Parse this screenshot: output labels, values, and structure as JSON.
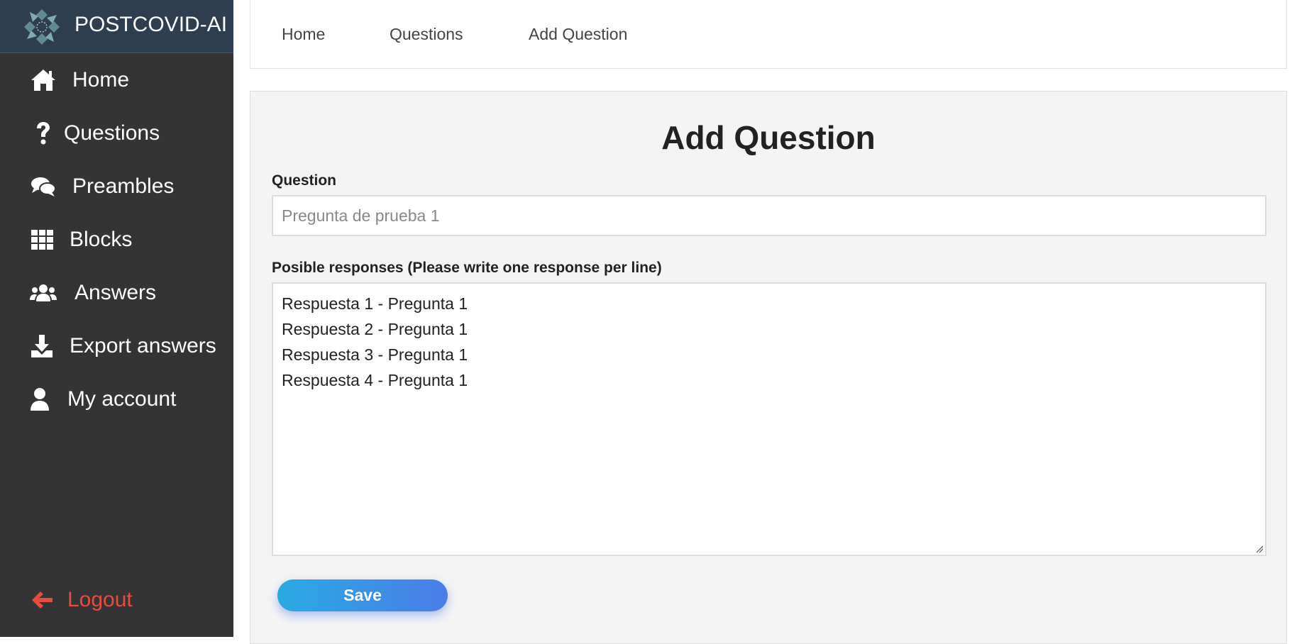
{
  "app": {
    "brand_name": "POSTCOVID-AI"
  },
  "sidebar": {
    "items": [
      {
        "label": "Home",
        "icon": "home-icon"
      },
      {
        "label": "Questions",
        "icon": "question-icon"
      },
      {
        "label": "Preambles",
        "icon": "comments-icon"
      },
      {
        "label": "Blocks",
        "icon": "grid-icon"
      },
      {
        "label": "Answers",
        "icon": "users-icon"
      },
      {
        "label": "Export answers",
        "icon": "download-icon"
      },
      {
        "label": "My account",
        "icon": "user-icon"
      }
    ],
    "logout": {
      "label": "Logout",
      "icon": "arrow-left-icon",
      "color": "#e74c3c"
    }
  },
  "topnav": {
    "links": [
      "Home",
      "Questions",
      "Add Question"
    ]
  },
  "form": {
    "title": "Add Question",
    "question_label": "Question",
    "question_placeholder": "Pregunta de prueba 1",
    "responses_label": "Posible responses (Please write one response per line)",
    "responses": [
      "Respuesta 1 - Pregunta 1",
      "Respuesta 2 - Pregunta 1",
      "Respuesta 3 - Pregunta 1",
      "Respuesta 4 - Pregunta 1"
    ],
    "save_label": "Save"
  },
  "colors": {
    "sidebar_bg": "#343434",
    "brand_bg": "#2c3e50",
    "logout": "#e74c3c",
    "save_gradient_start": "#29abe2",
    "save_gradient_end": "#4a7ce8"
  }
}
